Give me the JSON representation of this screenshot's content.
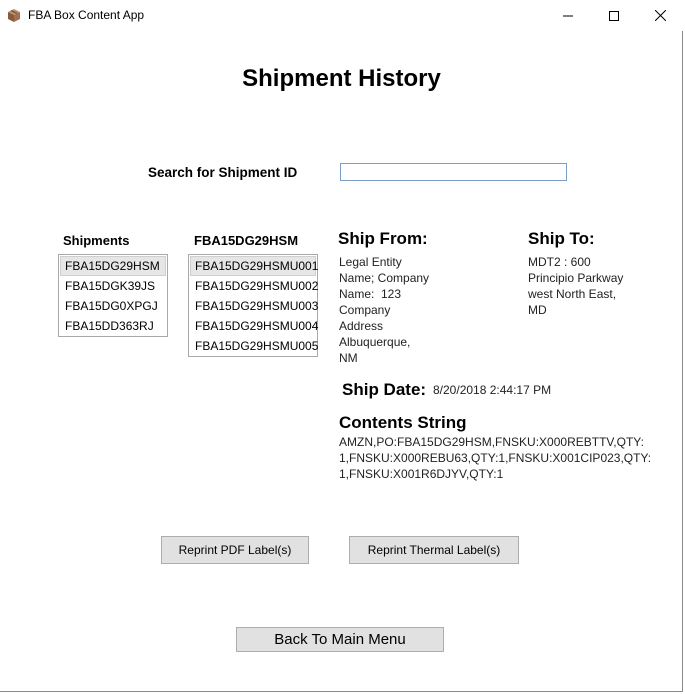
{
  "window": {
    "title": "FBA Box Content App"
  },
  "page": {
    "title": "Shipment History"
  },
  "search": {
    "label": "Search for Shipment ID",
    "value": ""
  },
  "shipments": {
    "heading": "Shipments",
    "items": [
      "FBA15DG29HSM",
      "FBA15DGK39JS",
      "FBA15DG0XPGJ",
      "FBA15DD363RJ"
    ],
    "selected_index": 0
  },
  "boxes": {
    "heading": "FBA15DG29HSM",
    "items": [
      "FBA15DG29HSMU001",
      "FBA15DG29HSMU002",
      "FBA15DG29HSMU003",
      "FBA15DG29HSMU004",
      "FBA15DG29HSMU005"
    ],
    "selected_index": 0
  },
  "ship_from": {
    "heading": "Ship From:",
    "lines": [
      "Legal Entity",
      "Name; Company",
      "Name:  123",
      "Company",
      "Address",
      "Albuquerque,",
      "NM"
    ]
  },
  "ship_to": {
    "heading": "Ship To:",
    "lines": [
      "MDT2 : 600",
      "Principio Parkway",
      "west North East,",
      "MD"
    ]
  },
  "ship_date": {
    "label": "Ship Date:",
    "value": "8/20/2018 2:44:17 PM"
  },
  "contents": {
    "heading": "Contents String",
    "lines": [
      "AMZN,PO:FBA15DG29HSM,FNSKU:X000REBTTV,QTY:",
      "1,FNSKU:X000REBU63,QTY:1,FNSKU:X001CIP023,QTY:",
      "1,FNSKU:X001R6DJYV,QTY:1"
    ]
  },
  "buttons": {
    "reprint_pdf": "Reprint PDF Label(s)",
    "reprint_thermal": "Reprint Thermal Label(s)",
    "back": "Back To Main Menu"
  }
}
